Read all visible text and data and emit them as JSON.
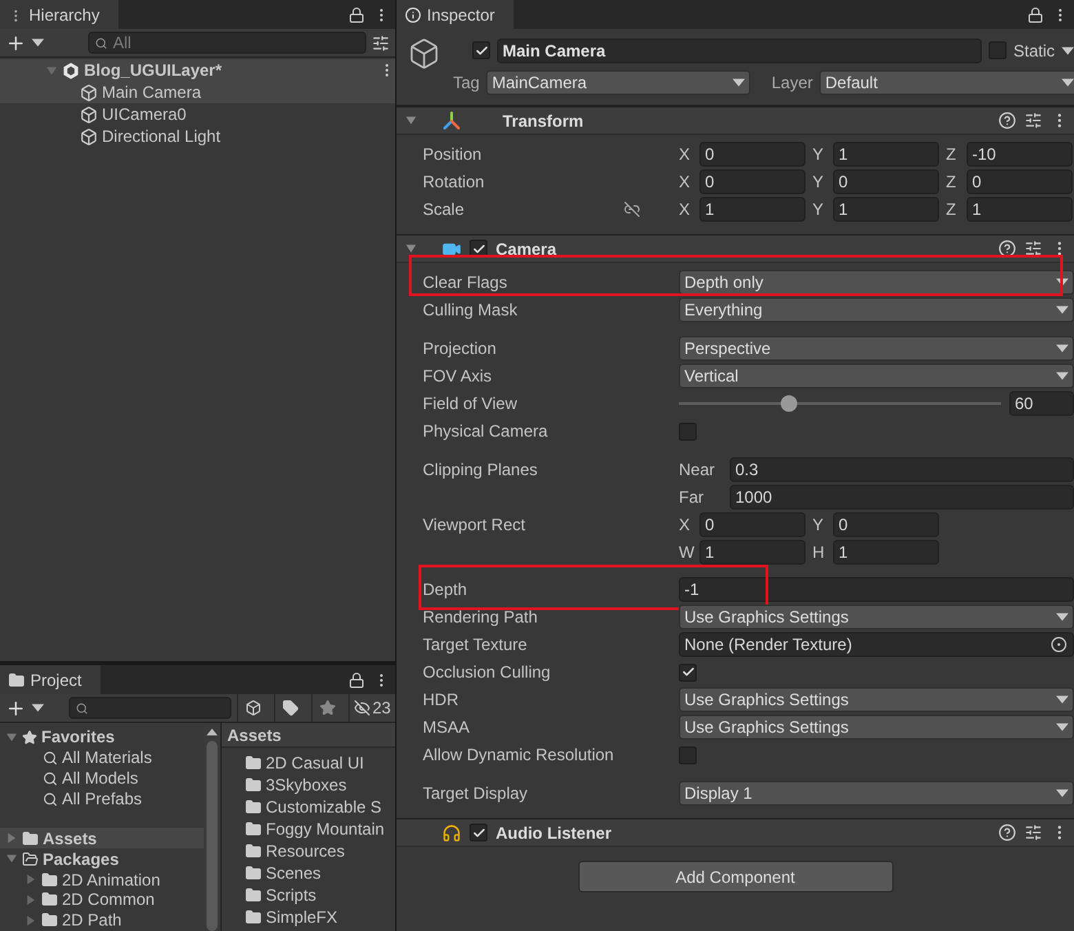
{
  "hierarchy": {
    "title": "Hierarchy",
    "search": {
      "placeholder": "All"
    },
    "scene": {
      "name": "Blog_UGUILayer*",
      "expanded": true,
      "children": [
        {
          "name": "Main Camera",
          "selected": true
        },
        {
          "name": "UICamera0",
          "selected": false
        },
        {
          "name": "Directional Light",
          "selected": false
        }
      ]
    }
  },
  "project": {
    "title": "Project",
    "hidden_count": "23",
    "favorites": {
      "label": "Favorites",
      "expanded": true,
      "items": [
        "All Materials",
        "All Models",
        "All Prefabs"
      ]
    },
    "tree": [
      {
        "label": "Assets",
        "selected": true,
        "expanded": false
      },
      {
        "label": "Packages",
        "selected": false,
        "expanded": true,
        "children": [
          {
            "label": "2D Animation",
            "expanded": false
          },
          {
            "label": "2D Common",
            "expanded": false
          },
          {
            "label": "2D Path",
            "expanded": false
          }
        ]
      }
    ],
    "breadcrumb": "Assets",
    "folders": [
      "2D Casual UI",
      "3Skyboxes",
      "Customizable S",
      "Foggy Mountain",
      "Resources",
      "Scenes",
      "Scripts",
      "SimpleFX"
    ]
  },
  "inspector": {
    "title": "Inspector",
    "object": {
      "active": true,
      "name": "Main Camera",
      "static": false,
      "static_label": "Static",
      "tag_label": "Tag",
      "tag": "MainCamera",
      "layer_label": "Layer",
      "layer": "Default"
    },
    "components": [
      {
        "kind": "transform",
        "name": "Transform",
        "expanded": true,
        "groups": [
          [
            {
              "kind": "vector",
              "label": "Position",
              "fields": [
                {
                  "axis": "X",
                  "value": "0"
                },
                {
                  "axis": "Y",
                  "value": "1"
                },
                {
                  "axis": "Z",
                  "value": "-10"
                }
              ]
            },
            {
              "kind": "vector",
              "label": "Rotation",
              "fields": [
                {
                  "axis": "X",
                  "value": "0"
                },
                {
                  "axis": "Y",
                  "value": "0"
                },
                {
                  "axis": "Z",
                  "value": "0"
                }
              ]
            },
            {
              "kind": "vector",
              "label": "Scale",
              "linked": false,
              "fields": [
                {
                  "axis": "X",
                  "value": "1"
                },
                {
                  "axis": "Y",
                  "value": "1"
                },
                {
                  "axis": "Z",
                  "value": "1"
                }
              ]
            }
          ]
        ]
      },
      {
        "kind": "camera",
        "name": "Camera",
        "enabled": true,
        "expanded": true,
        "groups": [
          [
            {
              "kind": "dropdown",
              "label": "Clear Flags",
              "value": "Depth only",
              "highlighted": true
            },
            {
              "kind": "dropdown",
              "label": "Culling Mask",
              "value": "Everything",
              "highlighted": false
            }
          ],
          [
            {
              "kind": "dropdown",
              "label": "Projection",
              "value": "Perspective",
              "highlighted": false
            },
            {
              "kind": "dropdown",
              "label": "FOV Axis",
              "value": "Vertical",
              "highlighted": false
            },
            {
              "kind": "slider",
              "label": "Field of View",
              "level": 0.34,
              "value": "60",
              "highlighted": false
            },
            {
              "kind": "checkbox",
              "label": "Physical Camera",
              "checked": false,
              "highlighted": false
            }
          ],
          [
            {
              "kind": "stack",
              "label": "Clipping Planes",
              "fields": [
                {
                  "axis": "Near",
                  "value": "0.3"
                },
                {
                  "axis": "Far",
                  "value": "1000"
                }
              ],
              "highlighted": false
            },
            {
              "kind": "vector",
              "label": "Viewport Rect",
              "fields": [
                {
                  "axis": "X",
                  "value": "0"
                },
                {
                  "axis": "Y",
                  "value": "0"
                },
                {
                  "axis": "W",
                  "value": "1"
                },
                {
                  "axis": "H",
                  "value": "1"
                }
              ],
              "highlighted": false
            }
          ],
          [
            {
              "kind": "field",
              "label": "Depth",
              "value": "-1",
              "highlighted": true
            },
            {
              "kind": "dropdown",
              "label": "Rendering Path",
              "value": "Use Graphics Settings",
              "highlighted": false
            },
            {
              "kind": "object",
              "label": "Target Texture",
              "value": "None (Render Texture)",
              "highlighted": false
            },
            {
              "kind": "checkbox",
              "label": "Occlusion Culling",
              "checked": true,
              "highlighted": false
            },
            {
              "kind": "dropdown",
              "label": "HDR",
              "value": "Use Graphics Settings",
              "highlighted": false
            },
            {
              "kind": "dropdown",
              "label": "MSAA",
              "value": "Use Graphics Settings",
              "highlighted": false
            },
            {
              "kind": "checkbox",
              "label": "Allow Dynamic Resolution",
              "checked": false,
              "highlighted": false
            }
          ],
          [
            {
              "kind": "dropdown",
              "label": "Target Display",
              "value": "Display 1",
              "highlighted": false
            }
          ]
        ]
      },
      {
        "kind": "audio",
        "name": "Audio Listener",
        "enabled": true
      }
    ],
    "add_button": "Add Component"
  }
}
